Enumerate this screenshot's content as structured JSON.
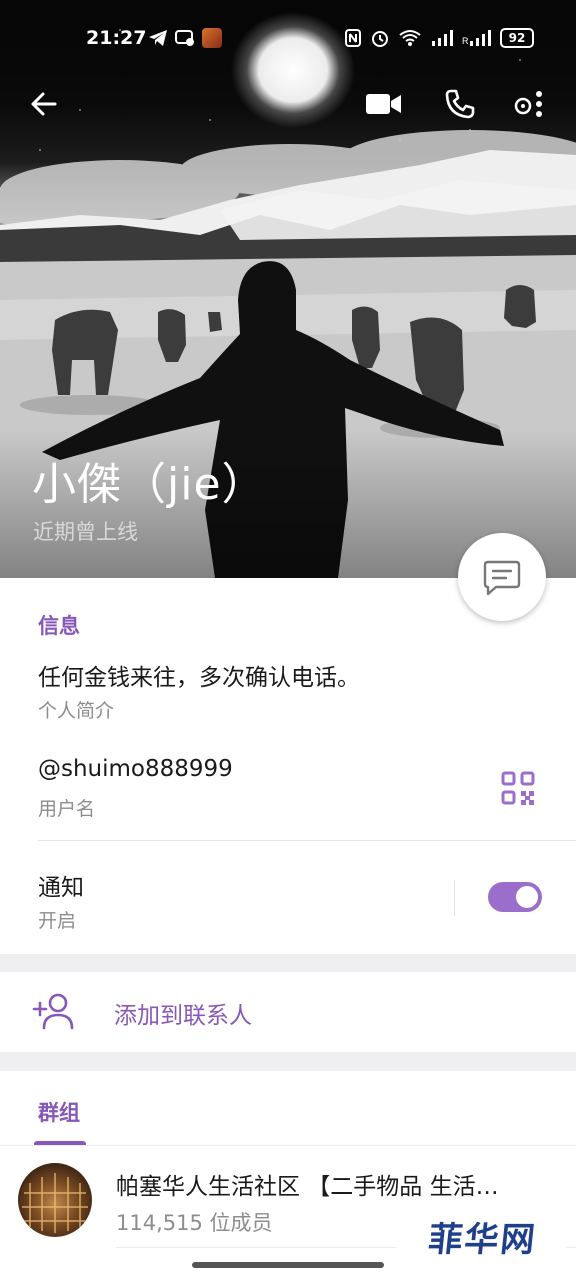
{
  "status_bar": {
    "time": "21:27",
    "battery": "92"
  },
  "header": {
    "back_icon": "arrow-left-icon",
    "video_icon": "video-call-icon",
    "call_icon": "phone-icon",
    "more_icon": "more-vertical-icon"
  },
  "profile": {
    "name": "小傑（jie）",
    "status": "近期曾上线"
  },
  "info": {
    "section_title": "信息",
    "bio_value": "任何金钱来往，多次确认电话。",
    "bio_label": "个人简介",
    "username_value": "@shuimo888999",
    "username_label": "用户名",
    "notifications_value": "通知",
    "notifications_label": "开启",
    "notifications_on": true
  },
  "actions": {
    "add_contact_label": "添加到联系人"
  },
  "groups": {
    "tab_label": "群组",
    "items": [
      {
        "name": "帕塞华人生活社区 【二手物品 生活…",
        "members": "114,515 位成员"
      }
    ]
  },
  "watermark": {
    "text": "菲华网"
  },
  "colors": {
    "accent": "#8758b8",
    "toggle": "#9b6ecb"
  }
}
